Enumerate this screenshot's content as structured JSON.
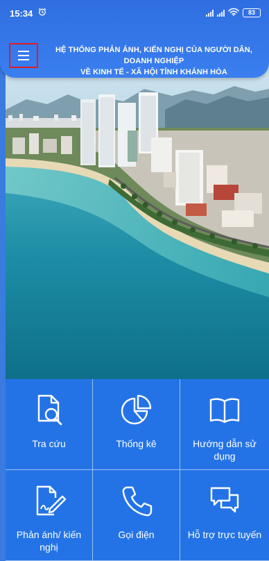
{
  "status_bar": {
    "time": "15:34",
    "battery": "83"
  },
  "header": {
    "title_line1": "Hệ thống phản ánh, kiến nghị của người dân, doanh nghiệp",
    "title_line2": "về kinh tế - xã hội tỉnh Khánh Hòa"
  },
  "hero": {
    "icon": "city-coast-photo"
  },
  "tiles": [
    {
      "label": "Tra cứu",
      "icon": "document-search-icon"
    },
    {
      "label": "Thống kê",
      "icon": "pie-chart-icon"
    },
    {
      "label": "Hướng dẫn sử dụng",
      "icon": "book-icon"
    },
    {
      "label": "Phản ánh/ kiến nghị",
      "icon": "document-edit-icon"
    },
    {
      "label": "Gọi điện",
      "icon": "phone-icon"
    },
    {
      "label": "Hỗ trợ trực tuyến",
      "icon": "chat-icon"
    }
  ],
  "colors": {
    "header_blue": "#2f6ee0",
    "tile_blue": "#2473e6",
    "highlight_red": "#e01b24"
  }
}
